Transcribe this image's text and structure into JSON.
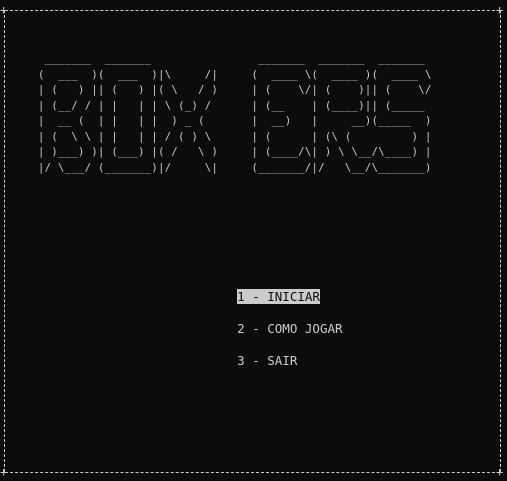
{
  "window": {
    "background": "#0c0c0c",
    "foreground": "#cccccc"
  },
  "border": {
    "corner_char": "+"
  },
  "title_art": {
    "lines": [
      " _______  _______                _______  _______  _______ ",
      "(  ___  )(  ___  )|\\     /|     (  ____ \\(  ____ )(  ____ \\",
      "| (   ) || (   ) |( \\   / )     | (    \\/| (    )|| (    \\/",
      "| (__/ / | |   | | \\ (_) /      | (__    | (____)|| (_____ ",
      "|  __ (  | |   | |  ) _ (       |  __)   |     __)(_____  )",
      "| (  \\ \\ | |   | | / ( ) \\      | (      | (\\ (         ) |",
      "| )___) )| (___) |( /   \\ )     | (____/\\| ) \\ \\__/\\____) |",
      "|/ \\___/ (_______)|/     \\|     (_______/|/   \\__/\\_______)"
    ]
  },
  "menu": {
    "items": [
      {
        "label": "1 - INICIAR",
        "selected": true
      },
      {
        "label": "2 - COMO JOGAR",
        "selected": false
      },
      {
        "label": "3 - SAIR",
        "selected": false
      }
    ],
    "highlight_color": "#cccccc"
  }
}
